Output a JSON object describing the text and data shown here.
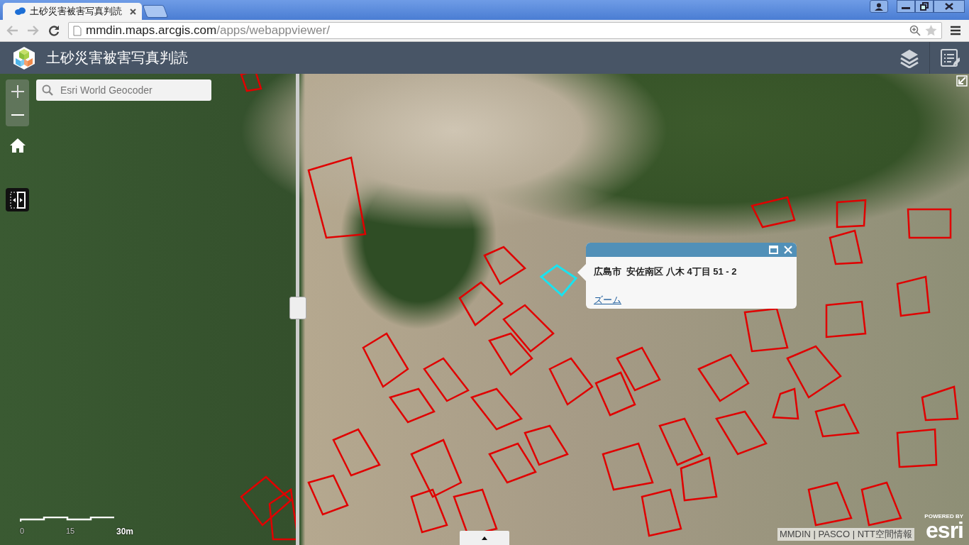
{
  "browser": {
    "tabs": [
      {
        "title": "土砂災害被害写真判読",
        "selected": true
      }
    ],
    "address": {
      "host": "mmdin.maps.arcgis.com",
      "path": "/apps/webappviewer/"
    }
  },
  "header": {
    "title": "土砂災害被害写真判読"
  },
  "search": {
    "placeholder": "Esri World Geocoder"
  },
  "popup": {
    "title": "広島市  安佐南区 八木 4丁目 51 - 2",
    "link": "ズーム"
  },
  "scale_bar": {
    "labels": [
      "0",
      "15",
      "30m"
    ]
  },
  "attribution": "MMDIN | PASCO | NTT空間情報",
  "esri": {
    "powered_by": "POWERED BY",
    "logo": "esri"
  }
}
